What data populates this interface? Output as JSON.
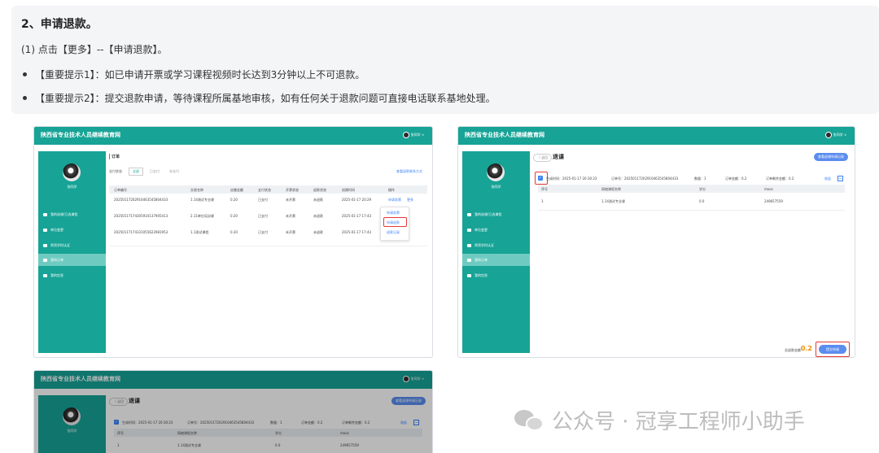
{
  "section": {
    "heading": "2、申请退款。",
    "step": "(1) 点击【更多】--【申请退款】。",
    "bullets": [
      "【重要提示1】：如已申请开票或学习课程视频时长达到3分钟以上不可退款。",
      "【重要提示2】：提交退款申请，等待课程所属基地审核，如有任何关于退款问题可直接电话联系基地处理。"
    ]
  },
  "app": {
    "brand": "陕西省专业技术人员继续教育网",
    "user": "张同学 ∨",
    "username": "张同学",
    "menu": [
      "我的选课/已选课程",
      "单位变更",
      "师资学时认证",
      "我的订单",
      "我的信息"
    ]
  },
  "orders": {
    "title": "订单",
    "filter_label": "支付状态",
    "filters": [
      "全部",
      "已支付",
      "未支付"
    ],
    "contact_link": "查看退款联系方式",
    "columns": [
      "订单编号",
      "交易名称",
      "应缴金额",
      "支付状态",
      "开票状态",
      "退款状态",
      "创建时间",
      "操作"
    ],
    "rows": [
      [
        "20250117202916463545804433",
        "1.14测试专业课",
        "0.20",
        "已支付",
        "未开票",
        "未退款",
        "2025-01-17 20:29",
        "申请发票",
        "更多"
      ],
      [
        "20250117174305910137905413",
        "2.11单位培训课",
        "0.20",
        "已支付",
        "未开票",
        "未退款",
        "2025-01-17 17:43",
        "",
        ""
      ],
      [
        "20250117174331055622981953",
        "1.1测试课程",
        "0.20",
        "已支付",
        "未开票",
        "未退款",
        "2025-01-17 17:43",
        "",
        ""
      ]
    ],
    "more_menu": [
      "申请发票",
      "申请退款",
      "退款记录"
    ]
  },
  "refund": {
    "back": "〈 返回",
    "title": "退课",
    "record_button": "查看退课申请记录",
    "info": {
      "time": "生成时间：2025-01-17 20:30:23",
      "order_no": "订单号：20250117202916463545804433",
      "quantity": "数量：1",
      "order_amount": "订单金额：0.2",
      "refundable": "订单剩余金额：0.2",
      "fold": "收起"
    },
    "columns": [
      "序号",
      "网络课程名称",
      "学分",
      "mooc"
    ],
    "row": [
      "1",
      "1.14测试专业课",
      "0.0",
      "249657559"
    ],
    "total_label": "总退款金额：",
    "total_value": "0.2",
    "submit_button": "提交申请"
  },
  "watermark": "公众号 · 冠享工程师小助手"
}
